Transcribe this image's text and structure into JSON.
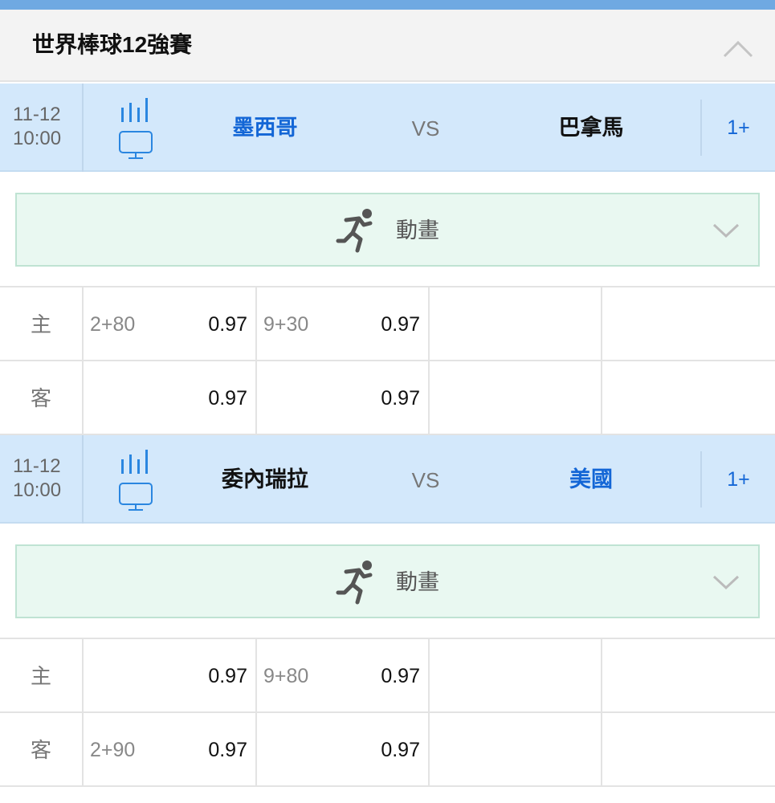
{
  "league": {
    "title": "世界棒球12強賽",
    "collapse_icon": "chevron-up-icon"
  },
  "matches": [
    {
      "date": "11-12",
      "time": "10:00",
      "home": "墨西哥",
      "vs": "VS",
      "away": "巴拿馬",
      "favored": "home",
      "more": "1+",
      "animation": {
        "label": "動畫",
        "icon": "running-man-icon",
        "chevron": "chevron-down-icon"
      },
      "odds": [
        {
          "side": "主",
          "hcp1": "2+80",
          "odds1": "0.97",
          "hcp2": "9+30",
          "odds2": "0.97"
        },
        {
          "side": "客",
          "hcp1": "",
          "odds1": "0.97",
          "hcp2": "",
          "odds2": "0.97"
        }
      ]
    },
    {
      "date": "11-12",
      "time": "10:00",
      "home": "委內瑞拉",
      "vs": "VS",
      "away": "美國",
      "favored": "away",
      "more": "1+",
      "animation": {
        "label": "動畫",
        "icon": "running-man-icon",
        "chevron": "chevron-down-icon"
      },
      "odds": [
        {
          "side": "主",
          "hcp1": "",
          "odds1": "0.97",
          "hcp2": "9+80",
          "odds2": "0.97"
        },
        {
          "side": "客",
          "hcp1": "2+90",
          "odds1": "0.97",
          "hcp2": "",
          "odds2": "0.97"
        }
      ]
    }
  ],
  "colors": {
    "header_bar": "#6fa9e2",
    "match_row_bg": "#d3e8fb",
    "favored_team": "#1366d6",
    "animation_bg": "#e9f8f1",
    "icon_blue": "#2a86e0"
  }
}
